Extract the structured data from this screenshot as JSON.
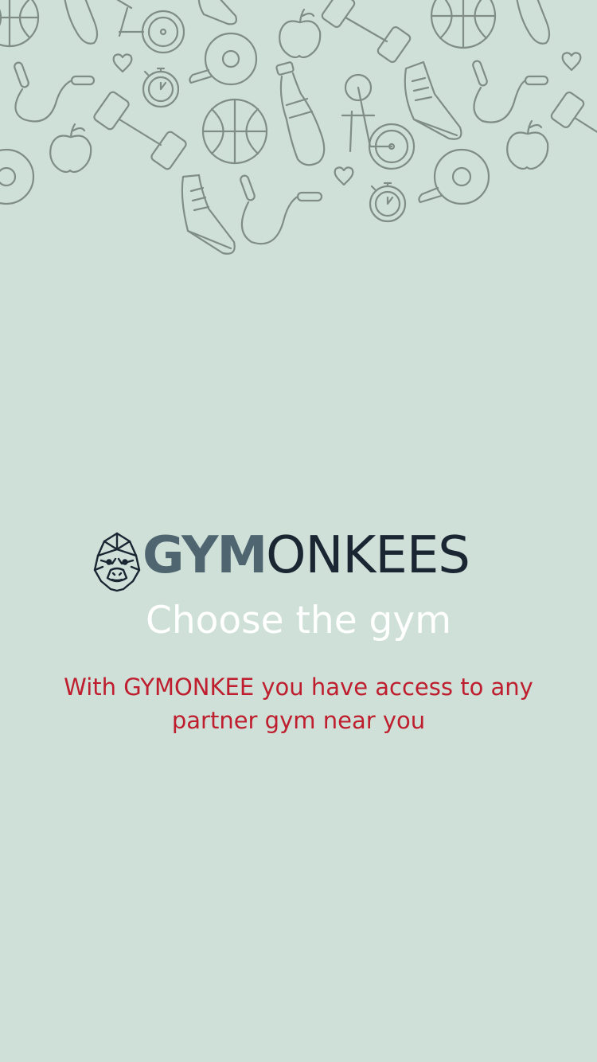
{
  "brand": {
    "name_bold": "GYM",
    "name_light": "ONKEES",
    "logo_icon": "gorilla-head-icon"
  },
  "onboarding": {
    "title": "Choose the gym",
    "description": "With GYMONKEE you have access to any partner gym near you"
  },
  "pattern": {
    "icons": [
      "basketball-icon",
      "dumbbell-icon",
      "stationary-bike-icon",
      "sneaker-icon",
      "apple-icon",
      "stopwatch-icon",
      "jump-rope-icon",
      "ping-pong-paddle-icon",
      "water-bottle-icon",
      "heart-icon"
    ]
  },
  "colors": {
    "background": "#cfe0d8",
    "doodle_stroke": "#7f8c87",
    "logo_bold": "#4f6670",
    "logo_light": "#1b2633",
    "title": "#ffffff",
    "description": "#be1e2d"
  }
}
